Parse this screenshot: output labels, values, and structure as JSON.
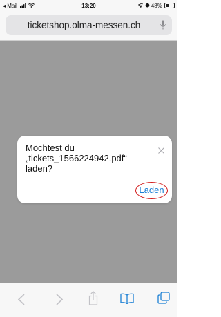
{
  "status_bar": {
    "carrier": "◂ Mail",
    "time": "13:20",
    "battery": "48%",
    "battery_level": 0.48
  },
  "browser": {
    "url": "ticketshop.olma-messen.ch"
  },
  "dialog": {
    "line1": "Möchtest du",
    "line2": "„tickets_1566224942.pdf“",
    "line3": "laden?",
    "button_label": "Laden"
  },
  "toolbar": {
    "icons": [
      "back-icon",
      "forward-icon",
      "share-icon",
      "bookmarks-icon",
      "tabs-icon"
    ]
  },
  "colors": {
    "accent": "#1a7fd4",
    "highlight_circle": "#d42222",
    "overlay": "#9b9b9b"
  }
}
